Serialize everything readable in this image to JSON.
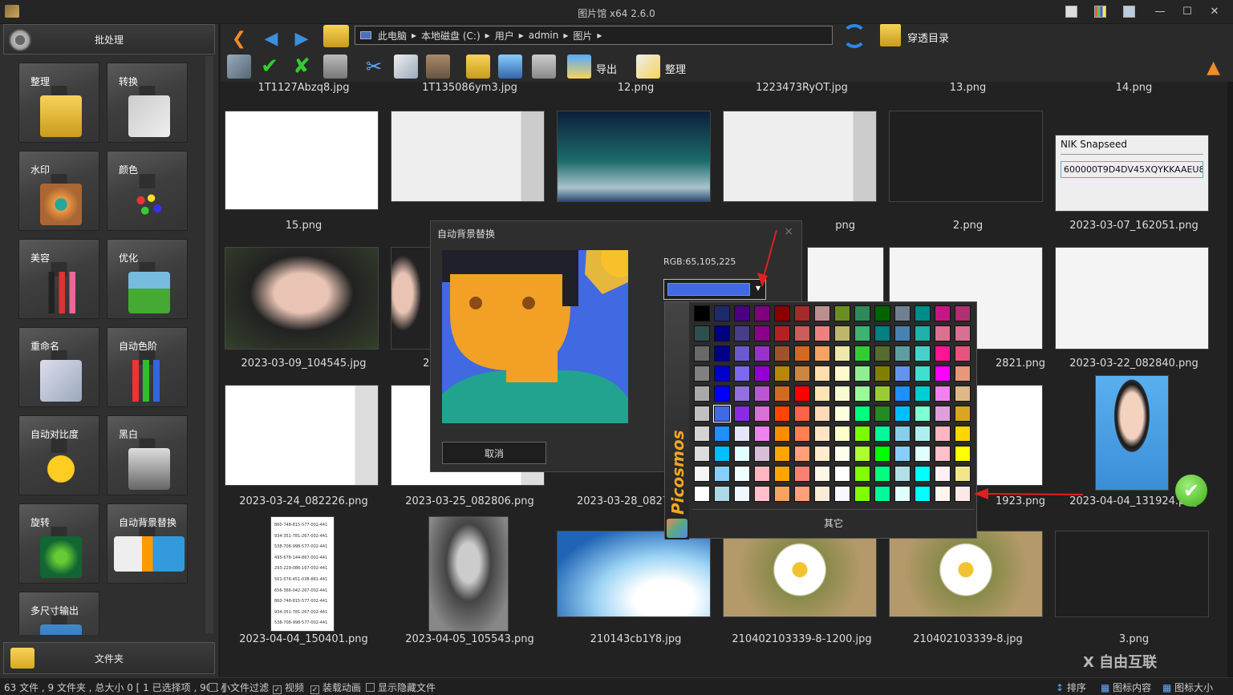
{
  "window": {
    "title": "图片馆 x64 2.6.0"
  },
  "sidebar": {
    "batch_label": "批处理",
    "folder_label": "文件夹",
    "tools": [
      {
        "label": "整理"
      },
      {
        "label": "转换"
      },
      {
        "label": "水印"
      },
      {
        "label": "颜色"
      },
      {
        "label": "美容"
      },
      {
        "label": "优化"
      },
      {
        "label": "重命名"
      },
      {
        "label": "自动色阶"
      },
      {
        "label": "自动对比度"
      },
      {
        "label": "黑白"
      },
      {
        "label": "旋转"
      },
      {
        "label": "自动背景替换"
      },
      {
        "label": "多尺寸输出"
      }
    ]
  },
  "address": {
    "segments": [
      "此电脑",
      "▸",
      "本地磁盘 (C:)",
      "▸",
      "用户",
      "▸",
      "admin",
      "▸",
      "图片",
      "▸"
    ]
  },
  "toolbar": {
    "pass_label": "穿透目录",
    "export_label": "导出",
    "organize_label": "整理"
  },
  "grid": {
    "top_row": [
      "1T1127Abzq8.jpg",
      "1T135086ym3.jpg",
      "12.png",
      "1223473RyOT.jpg",
      "13.png",
      "14.png"
    ],
    "row1": [
      "15.png",
      "",
      "",
      "png",
      "2.png",
      "2023-03-07_162051.png"
    ],
    "row2": [
      "2023-03-09_104545.jpg",
      "202",
      "",
      "",
      "2821.png",
      "2023-03-22_082840.png"
    ],
    "row3": [
      "2023-03-24_082226.png",
      "2023-03-25_082806.png",
      "2023-03-28_08270",
      "",
      "1923.png",
      "2023-04-04_131924.png"
    ],
    "row4": [
      "2023-04-04_150401.png",
      "2023-04-05_105543.png",
      "210143cb1Y8.jpg",
      "210402103339-8-1200.jpg",
      "210402103339-8.jpg",
      "3.png"
    ],
    "snapseed": {
      "line1": "NIK Snapseed",
      "line2": "600000T9D4DV45XQYKKAAEU85"
    },
    "doc_numbers": [
      "860-748-815-577-002-441",
      "934-351-781-267-002-441",
      "538-708-998-577-002-441",
      "495-678-144-867-002-441",
      "293-229-086-167-002-441",
      "501-076-451-038-881-441",
      "656-366-042-267-002-441",
      "860-748-815-577-002-441",
      "934-351-781-267-002-441",
      "538-708-998-577-002-441",
      "495-678-144-867-002-441"
    ]
  },
  "dialog": {
    "title": "自动背景替换",
    "close": "×",
    "rgb": "RGB:65,105,225",
    "selected_color": "#4169e1",
    "cancel": "取消"
  },
  "picker": {
    "brand": "Picosmos",
    "other": "其它",
    "colors": [
      [
        "#000000",
        "#1f2a6b",
        "#4b0082",
        "#800080",
        "#8b0000",
        "#a52a2a",
        "#bc8f8f",
        "#6b8e23",
        "#2e8b57",
        "#006400",
        "#708090",
        "#008b8b",
        "#c71585",
        "#b03070"
      ],
      [
        "#2f4f4f",
        "#000080",
        "#483d8b",
        "#8b008b",
        "#b22222",
        "#cd5c5c",
        "#f08080",
        "#bdb76b",
        "#3cb371",
        "#008080",
        "#4682b4",
        "#20b2aa",
        "#db7093",
        "#d87093"
      ],
      [
        "#696969",
        "#00008b",
        "#6a5acd",
        "#9932cc",
        "#a0522d",
        "#d2691e",
        "#f4a460",
        "#eee8aa",
        "#32cd32",
        "#556b2f",
        "#5f9ea0",
        "#48d1cc",
        "#ff1493",
        "#e75480"
      ],
      [
        "#808080",
        "#0000cd",
        "#7b68ee",
        "#9400d3",
        "#b8860b",
        "#cd853f",
        "#ffdead",
        "#fffacd",
        "#90ee90",
        "#808000",
        "#6495ed",
        "#40e0d0",
        "#ff00ff",
        "#e9967a"
      ],
      [
        "#a9a9a9",
        "#0000ff",
        "#9370db",
        "#ba55d3",
        "#d2691e",
        "#ff0000",
        "#ffe4b5",
        "#fafad2",
        "#98fb98",
        "#9acd32",
        "#1e90ff",
        "#00ced1",
        "#ee82ee",
        "#deb887"
      ],
      [
        "#c0c0c0",
        "#4169e1",
        "#8a2be2",
        "#da70d6",
        "#ff4500",
        "#ff6347",
        "#ffdab9",
        "#ffffe0",
        "#00ff7f",
        "#228b22",
        "#00bfff",
        "#7fffd4",
        "#dda0dd",
        "#daa520"
      ],
      [
        "#d3d3d3",
        "#1e90ff",
        "#e6e6fa",
        "#ee82ee",
        "#ff8c00",
        "#ff7f50",
        "#ffe4c4",
        "#ffffcc",
        "#7cfc00",
        "#00fa9a",
        "#87ceeb",
        "#afeeee",
        "#ffb6c1",
        "#ffd700"
      ],
      [
        "#dcdcdc",
        "#00bfff",
        "#e0ffff",
        "#d8bfd8",
        "#ffa500",
        "#ffa07a",
        "#ffebcd",
        "#fffff0",
        "#adff2f",
        "#00ff00",
        "#87cefa",
        "#e0ffff",
        "#ffc0cb",
        "#ffff00"
      ],
      [
        "#f5f5f5",
        "#87cefa",
        "#f0ffff",
        "#ffb6c1",
        "#ffa500",
        "#fa8072",
        "#fdf5e6",
        "#ffffff",
        "#7fff00",
        "#00ff7f",
        "#b0e0e6",
        "#00ffff",
        "#fff0f5",
        "#f0e68c"
      ],
      [
        "#ffffff",
        "#add8e6",
        "#f0f8ff",
        "#ffc0cb",
        "#f4a460",
        "#ffa07a",
        "#faebd7",
        "#f8f8ff",
        "#7fff00",
        "#00fa9a",
        "#e0ffff",
        "#00ffff",
        "#fff5ee",
        "#fbe9e7"
      ]
    ]
  },
  "status": {
    "summary": "63 文件 , 9 文件夹 , 总大小 0 [ 1 已选择项 , 90K ]",
    "opt1": "小文件过滤",
    "opt2": "视频",
    "opt3": "装载动画",
    "opt4": "显示隐藏文件",
    "sort": "排序",
    "icon_content": "图标内容",
    "icon_size": "图标大小"
  },
  "watermark": "X 自由互联"
}
